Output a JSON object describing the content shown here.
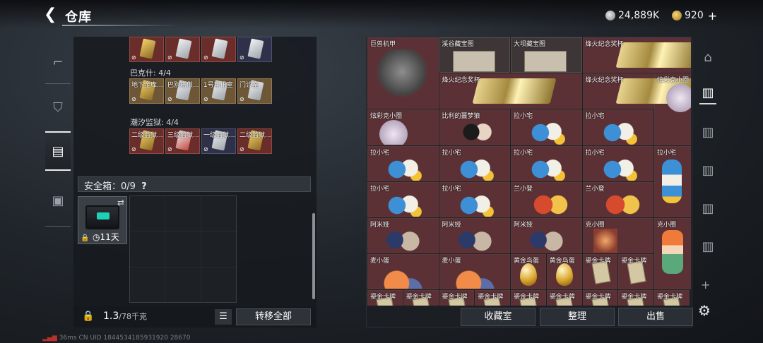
{
  "header": {
    "title": "仓库"
  },
  "currency": {
    "silver": "24,889K",
    "gold": "920"
  },
  "left": {
    "sections": [
      {
        "label": "巴克什: 4/4",
        "cards": [
          {
            "name": "",
            "style": "",
            "card": "y"
          },
          {
            "name": "",
            "style": "",
            "card": ""
          },
          {
            "name": "",
            "style": "",
            "card": ""
          },
          {
            "name": "",
            "style": "blue",
            "card": ""
          }
        ]
      },
      {
        "label": "潮汐监狱: 4/4",
        "cards": [
          {
            "name": "地下金库...",
            "style": "gold",
            "card": "y"
          },
          {
            "name": "巴别塔供...",
            "style": "gold",
            "card": ""
          },
          {
            "name": "1号审讯室",
            "style": "gold",
            "card": ""
          },
          {
            "name": "门诊室",
            "style": "gold",
            "card": ""
          }
        ]
      },
      {
        "label": "",
        "cards": [
          {
            "name": "二级监狱...",
            "style": "",
            "card": "y"
          },
          {
            "name": "三级监狱...",
            "style": "",
            "card": "r"
          },
          {
            "name": "一级监狱...",
            "style": "blue",
            "card": ""
          },
          {
            "name": "二级监狱...",
            "style": "",
            "card": "y"
          }
        ]
      }
    ],
    "safe_label": "安全箱：0/9",
    "safe_days": "11天",
    "weight_main": "1.3",
    "weight_cap": "/78千克",
    "transfer_all": "转移全部"
  },
  "right": {
    "items": [
      {
        "name": "巨兽机甲",
        "c": 0,
        "r": 0,
        "w": 1,
        "h": 2,
        "art": "mech",
        "bg": "r"
      },
      {
        "name": "溪谷藏宝图",
        "c": 1,
        "r": 0,
        "w": 1,
        "h": 1,
        "art": "map",
        "bg": "g"
      },
      {
        "name": "大坝藏宝图",
        "c": 2,
        "r": 0,
        "w": 1,
        "h": 1,
        "art": "map",
        "bg": "g"
      },
      {
        "name": "烽火纪念奖杯",
        "c": 3,
        "r": 0,
        "w": 2,
        "h": 1,
        "art": "trophy",
        "bg": "r"
      },
      {
        "name": "烽火纪念奖杯",
        "c": 1,
        "r": 1,
        "w": 2,
        "h": 1,
        "art": "trophy",
        "bg": "r"
      },
      {
        "name": "烽火纪念奖杯",
        "c": 3,
        "r": 1,
        "w": 2,
        "h": 1,
        "art": "trophy",
        "bg": "r"
      },
      {
        "name": "炫彩克小圈",
        "c": 4,
        "r": 1,
        "w": 1,
        "h": 2,
        "art": "pinkdoll",
        "bg": "r"
      },
      {
        "name": "炫彩克小圈",
        "c": 0,
        "r": 2,
        "w": 1,
        "h": 1,
        "art": "pinkdoll",
        "bg": "r"
      },
      {
        "name": "比利的噩梦狼",
        "c": 1,
        "r": 2,
        "w": 1,
        "h": 1,
        "art": "doll2",
        "bg": "r"
      },
      {
        "name": "拉小宅",
        "c": 2,
        "r": 2,
        "w": 1,
        "h": 1,
        "art": "doll",
        "bg": "r"
      },
      {
        "name": "拉小宅",
        "c": 3,
        "r": 2,
        "w": 1,
        "h": 1,
        "art": "doll",
        "bg": "r"
      },
      {
        "name": "拉小宅",
        "c": 0,
        "r": 3,
        "w": 1,
        "h": 1,
        "art": "doll",
        "bg": "r"
      },
      {
        "name": "拉小宅",
        "c": 1,
        "r": 3,
        "w": 1,
        "h": 1,
        "art": "doll",
        "bg": "r"
      },
      {
        "name": "拉小宅",
        "c": 2,
        "r": 3,
        "w": 1,
        "h": 1,
        "art": "doll",
        "bg": "r"
      },
      {
        "name": "拉小宅",
        "c": 3,
        "r": 3,
        "w": 1,
        "h": 1,
        "art": "doll",
        "bg": "r"
      },
      {
        "name": "拉小宅",
        "c": 4,
        "r": 3,
        "w": 1,
        "h": 2,
        "art": "dollv",
        "bg": "r"
      },
      {
        "name": "拉小宅",
        "c": 0,
        "r": 4,
        "w": 1,
        "h": 1,
        "art": "doll",
        "bg": "r"
      },
      {
        "name": "拉小宅",
        "c": 1,
        "r": 4,
        "w": 1,
        "h": 1,
        "art": "doll",
        "bg": "r"
      },
      {
        "name": "兰小登",
        "c": 2,
        "r": 4,
        "w": 1,
        "h": 1,
        "art": "pig",
        "bg": "r"
      },
      {
        "name": "兰小登",
        "c": 3,
        "r": 4,
        "w": 1,
        "h": 1,
        "art": "pig",
        "bg": "r"
      },
      {
        "name": "阿米娅",
        "c": 0,
        "r": 5,
        "w": 1,
        "h": 1,
        "art": "bunny",
        "bg": "r"
      },
      {
        "name": "阿米娅",
        "c": 1,
        "r": 5,
        "w": 1,
        "h": 1,
        "art": "bunny",
        "bg": "r"
      },
      {
        "name": "阿米娅",
        "c": 2,
        "r": 5,
        "w": 1,
        "h": 1,
        "art": "bunny",
        "bg": "r"
      },
      {
        "name": "克小圈",
        "c": 3,
        "r": 5,
        "w": 1,
        "h": 1,
        "art": "cg",
        "bg": "r"
      },
      {
        "name": "克小圈",
        "c": 4,
        "r": 5,
        "w": 1,
        "h": 2,
        "art": "girl",
        "bg": "r"
      },
      {
        "name": "麦小蛋",
        "c": 0,
        "r": 6,
        "w": 1,
        "h": 1,
        "art": "bigdoll",
        "bg": "r"
      },
      {
        "name": "麦小蛋",
        "c": 1,
        "r": 6,
        "w": 1,
        "h": 1,
        "art": "bigdoll",
        "bg": "r"
      },
      {
        "name": "黄金鸟蛋",
        "c": 2,
        "r": 6,
        "w": 0.5,
        "h": 1,
        "art": "egg",
        "bg": "r"
      },
      {
        "name": "黄金鸟蛋",
        "c": 2.5,
        "r": 6,
        "w": 0.5,
        "h": 1,
        "art": "egg",
        "bg": "r"
      },
      {
        "name": "鎏金卡牌",
        "c": 3,
        "r": 6,
        "w": 0.5,
        "h": 1,
        "art": "card2",
        "bg": "r"
      },
      {
        "name": "鎏金卡牌",
        "c": 3.5,
        "r": 6,
        "w": 0.5,
        "h": 1,
        "art": "card2",
        "bg": "r"
      },
      {
        "name": "鎏金卡牌",
        "c": 0,
        "r": 7,
        "w": 0.5,
        "h": 1,
        "art": "card2",
        "bg": "r"
      },
      {
        "name": "鎏金卡牌",
        "c": 0.5,
        "r": 7,
        "w": 0.5,
        "h": 1,
        "art": "card2",
        "bg": "r"
      },
      {
        "name": "鎏金卡牌",
        "c": 1,
        "r": 7,
        "w": 0.5,
        "h": 1,
        "art": "card2",
        "bg": "r"
      },
      {
        "name": "鎏金卡牌",
        "c": 1.5,
        "r": 7,
        "w": 0.5,
        "h": 1,
        "art": "card2",
        "bg": "r"
      },
      {
        "name": "鎏金卡牌",
        "c": 2,
        "r": 7,
        "w": 0.5,
        "h": 1,
        "art": "card2",
        "bg": "r"
      },
      {
        "name": "鎏金卡牌",
        "c": 2.5,
        "r": 7,
        "w": 0.5,
        "h": 1,
        "art": "card2",
        "bg": "r"
      },
      {
        "name": "鎏金卡牌",
        "c": 3,
        "r": 7,
        "w": 0.5,
        "h": 1,
        "art": "card2",
        "bg": "r"
      },
      {
        "name": "鎏金卡牌",
        "c": 3.5,
        "r": 7,
        "w": 0.5,
        "h": 1,
        "art": "card2",
        "bg": "r"
      },
      {
        "name": "鎏金卡牌",
        "c": 4,
        "r": 7,
        "w": 0.5,
        "h": 1,
        "art": "card2",
        "bg": "r"
      }
    ],
    "actions": {
      "collection": "收藏室",
      "sort": "整理",
      "sell": "出售"
    }
  },
  "status": {
    "ping": "36ms",
    "uid": "CN UID 1844534185931920 28670"
  }
}
